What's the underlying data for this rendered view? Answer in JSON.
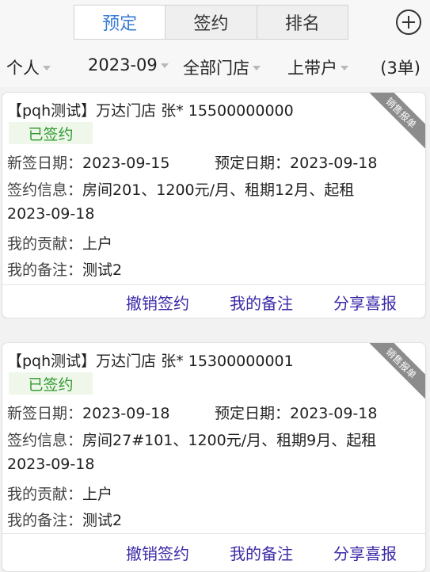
{
  "tabs": [
    {
      "label": "预定",
      "active": true
    },
    {
      "label": "签约",
      "active": false
    },
    {
      "label": "排名",
      "active": false
    }
  ],
  "add_icon": "plus-circle-icon",
  "filters": {
    "person": "个人",
    "month": "2023-09",
    "store": "全部门店",
    "scope": "上带户",
    "count": "(3单)"
  },
  "colors": {
    "tab_active_text": "#3a7bd5",
    "badge_text": "#2f9a2f",
    "badge_bg": "#eef7ea",
    "action_text": "#3b2aa8",
    "ribbon_bg": "#8c8c8c"
  },
  "cards": [
    {
      "title": "【pqh测试】万达门店 张* 15500000000",
      "ribbon": "销售报单",
      "status": "已签约",
      "new_sign_label": "新签日期：",
      "new_sign_date": "2023-09-15",
      "reserve_label": "预定日期：",
      "reserve_date": "2023-09-18",
      "contract_label": "签约信息：",
      "contract_info": "房间201、1200元/月、租期12月、起租",
      "contract_info_cont": "2023-09-18",
      "contribution_label": "我的贡献：",
      "contribution": "上户",
      "note_label": "我的备注：",
      "note": "测试2",
      "actions": [
        "撤销签约",
        "我的备注",
        "分享喜报"
      ]
    },
    {
      "title": "【pqh测试】万达门店 张* 15300000001",
      "ribbon": "销售报单",
      "status": "已签约",
      "new_sign_label": "新签日期：",
      "new_sign_date": "2023-09-18",
      "reserve_label": "预定日期：",
      "reserve_date": "2023-09-18",
      "contract_label": "签约信息：",
      "contract_info": "房间27#101、1200元/月、租期9月、起租",
      "contract_info_cont": "2023-09-18",
      "contribution_label": "我的贡献：",
      "contribution": "上户",
      "note_label": "我的备注：",
      "note": "测试2",
      "actions": [
        "撤销签约",
        "我的备注",
        "分享喜报"
      ]
    }
  ]
}
